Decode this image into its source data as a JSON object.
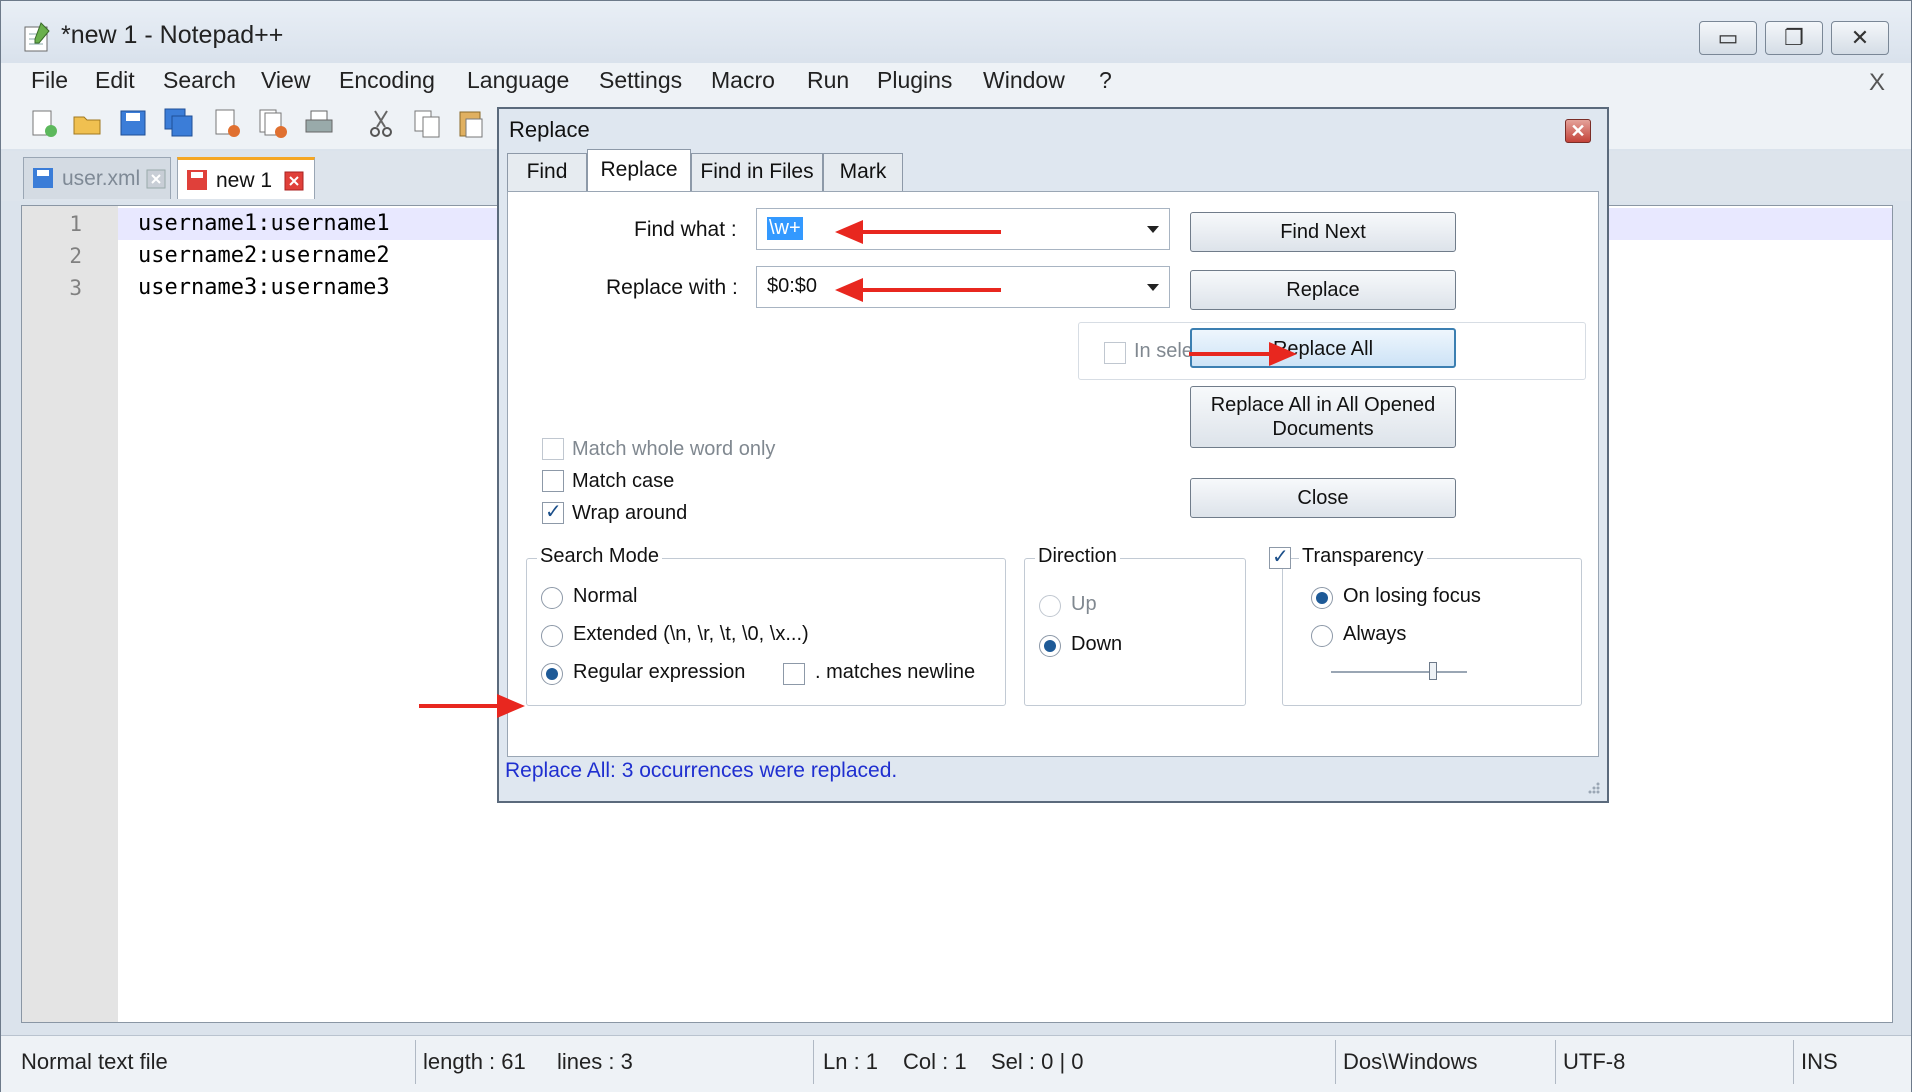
{
  "window": {
    "title": "*new 1 - Notepad++",
    "menu_close": "X"
  },
  "window_buttons": {
    "minimize": "▭",
    "restore": "❐",
    "close": "✕"
  },
  "menu": [
    "File",
    "Edit",
    "Search",
    "View",
    "Encoding",
    "Language",
    "Settings",
    "Macro",
    "Run",
    "Plugins",
    "Window",
    "?"
  ],
  "toolbar_icons": [
    "new-icon",
    "open-icon",
    "save-icon",
    "save-all-icon",
    "close-icon",
    "close-all-icon",
    "print-icon",
    "cut-icon",
    "copy-icon",
    "paste-icon"
  ],
  "tabs": [
    {
      "label": "user.xml",
      "active": false
    },
    {
      "label": "new 1",
      "active": true
    }
  ],
  "editor": {
    "line_numbers": [
      "1",
      "2",
      "3"
    ],
    "lines": [
      "username1:username1",
      "username2:username2",
      "username3:username3"
    ]
  },
  "status": {
    "file_type": "Normal text file",
    "length": "length : 61",
    "lines": "lines : 3",
    "ln": "Ln : 1",
    "col": "Col : 1",
    "sel": "Sel : 0 | 0",
    "eol": "Dos\\Windows",
    "encoding": "UTF-8",
    "mode": "INS"
  },
  "dialog": {
    "title": "Replace",
    "close": "✕",
    "tabs": [
      "Find",
      "Replace",
      "Find in Files",
      "Mark"
    ],
    "active_tab": "Replace",
    "find_label": "Find what :",
    "find_value": "\\w+",
    "replace_label": "Replace with :",
    "replace_value": "$0:$0",
    "in_selection": "In selection",
    "buttons": {
      "find_next": "Find Next",
      "replace": "Replace",
      "replace_all": "Replace All",
      "replace_all_opened_1": "Replace All in All Opened",
      "replace_all_opened_2": "Documents",
      "close": "Close"
    },
    "options": {
      "match_whole_word": "Match whole word only",
      "match_case": "Match case",
      "wrap_around": "Wrap around"
    },
    "search_mode": {
      "title": "Search Mode",
      "normal": "Normal",
      "extended": "Extended (\\n, \\r, \\t, \\0, \\x...)",
      "regex": "Regular expression",
      "matches_newline": ". matches newline"
    },
    "direction": {
      "title": "Direction",
      "up": "Up",
      "down": "Down"
    },
    "transparency": {
      "title": "Transparency",
      "on_losing_focus": "On losing focus",
      "always": "Always"
    },
    "message": "Replace All: 3 occurrences were replaced."
  },
  "colors": {
    "annotation_arrow": "#e8271f",
    "status_message": "#1f2fd0",
    "selection": "#3399ff"
  }
}
